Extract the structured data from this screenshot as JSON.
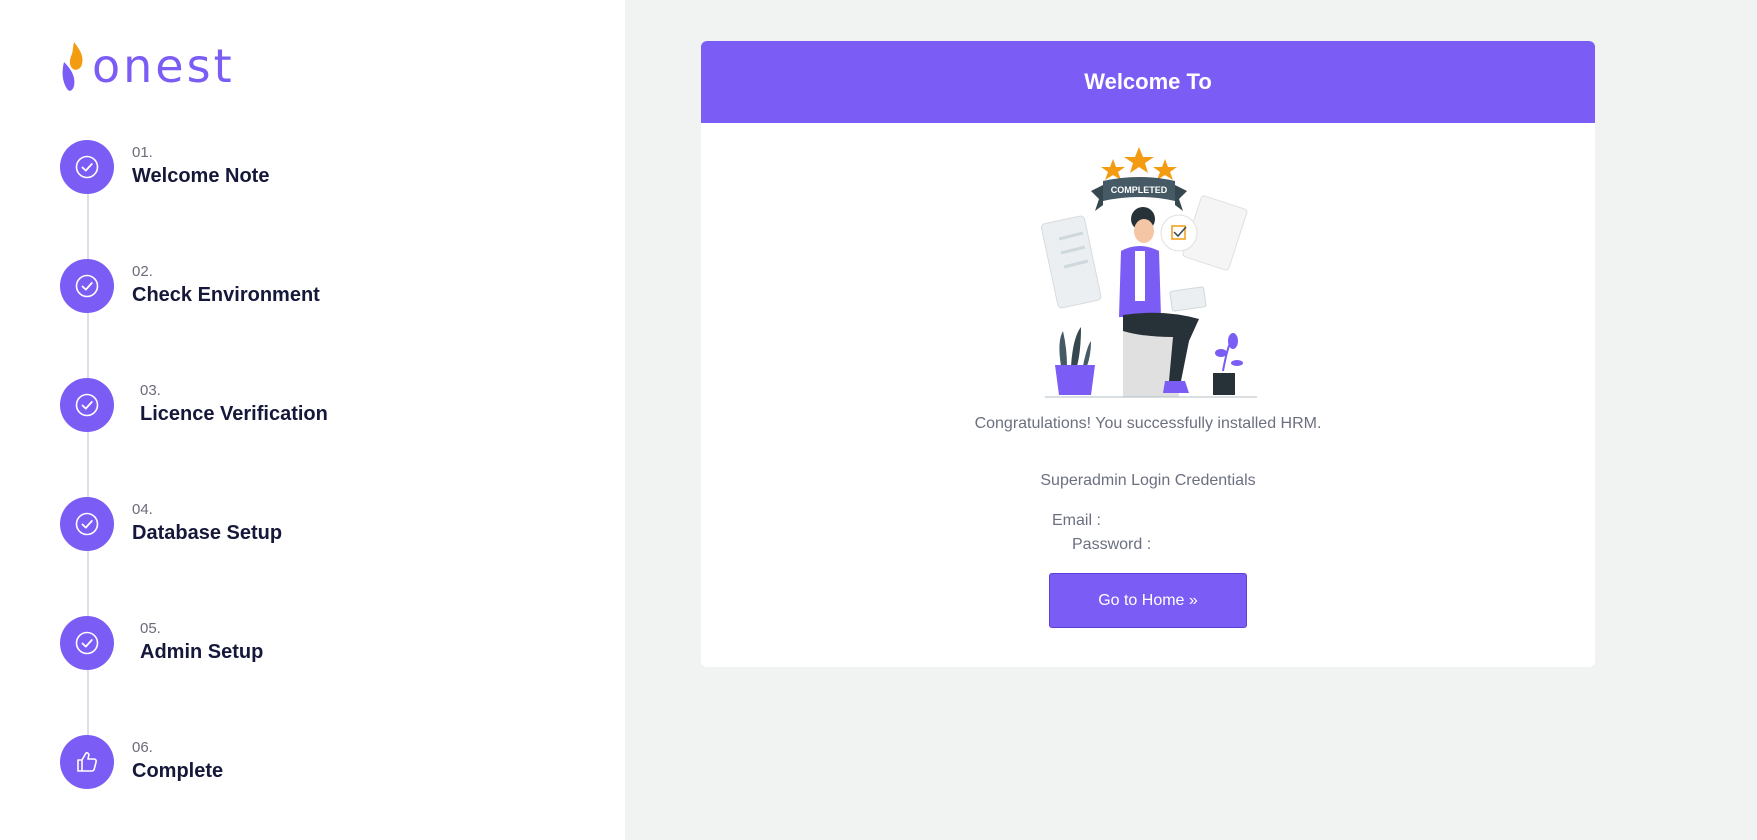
{
  "brand": {
    "name": "onest",
    "accent": "#7b5cf5",
    "flame": "#f39c12"
  },
  "steps": [
    {
      "number": "01.",
      "title": "Welcome Note",
      "icon": "check-circle-icon"
    },
    {
      "number": "02.",
      "title": "Check Environment",
      "icon": "check-circle-icon"
    },
    {
      "number": "03.",
      "title": "Licence Verification",
      "icon": "check-circle-icon"
    },
    {
      "number": "04.",
      "title": "Database Setup",
      "icon": "check-circle-icon"
    },
    {
      "number": "05.",
      "title": "Admin Setup",
      "icon": "check-circle-icon"
    },
    {
      "number": "06.",
      "title": "Complete",
      "icon": "thumbs-up-icon"
    }
  ],
  "card": {
    "title": "Welcome To",
    "illustration_badge": "COMPLETED",
    "congrats": "Congratulations! You successfully installed HRM.",
    "credentials_title": "Superadmin Login Credentials",
    "email_label": "Email :",
    "password_label": "Password :",
    "home_button": "Go to Home »"
  }
}
